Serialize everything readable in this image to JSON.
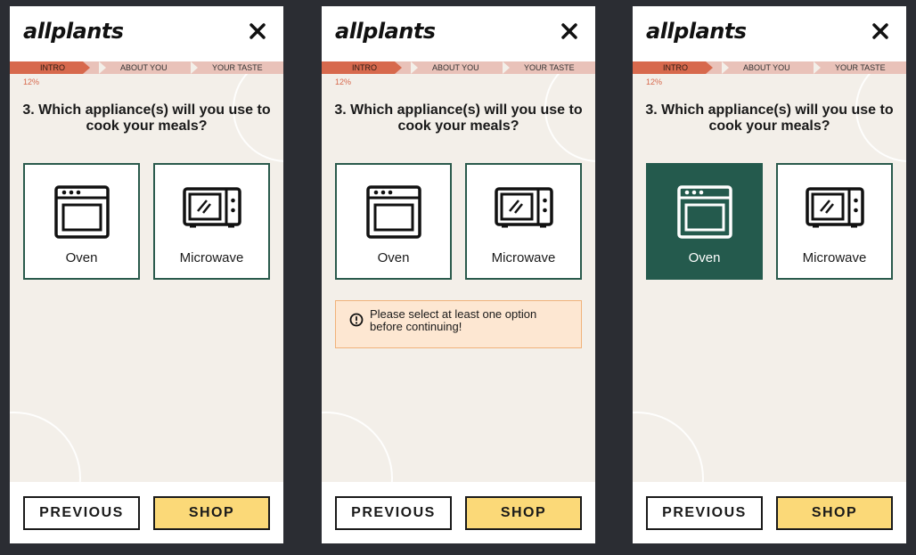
{
  "app": {
    "logo": "allplants",
    "steps": [
      "INTRO",
      "ABOUT YOU",
      "YOUR TASTE"
    ],
    "progress_percent_label": "12%",
    "progress_fraction": 0.12,
    "question": "3. Which appliance(s) will you use to cook your meals?",
    "options": [
      {
        "label": "Oven",
        "icon": "oven-icon"
      },
      {
        "label": "Microwave",
        "icon": "microwave-icon"
      }
    ],
    "warning": "Please select at least one option before continuing!",
    "buttons": {
      "previous": "PREVIOUS",
      "shop": "SHOP"
    }
  },
  "colors": {
    "accent": "#d7694d",
    "progress_track": "#e9c2b9",
    "selected": "#245a4d",
    "shop_button": "#fbd978",
    "warning_bg": "#fde7d2",
    "background": "#f3efe9"
  },
  "screens": [
    {
      "selected": "none",
      "warning_visible": false
    },
    {
      "selected": "none",
      "warning_visible": true
    },
    {
      "selected": "Oven",
      "warning_visible": false
    }
  ]
}
